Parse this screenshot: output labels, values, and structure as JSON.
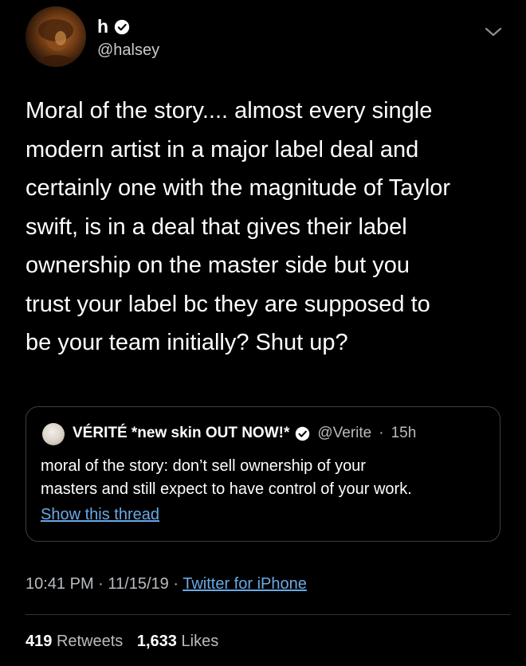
{
  "tweet": {
    "author": {
      "display_name": "h",
      "handle": "@halsey",
      "verified": true
    },
    "text": "Moral of the story.... almost every single\nmodern artist in a major label deal and\ncertainly one with the magnitude of Taylor\nswift, is in a deal that gives their label\nownership on the master side but you\ntrust your label bc they are supposed to\nbe your team initially? Shut up?",
    "quoted": {
      "display_name": "VÉRITÉ *new skin OUT NOW!*",
      "handle": "@Verite",
      "separator": "·",
      "age": "15h",
      "verified": true,
      "text": "moral of the story: don’t sell ownership of your\nmasters and still expect to have control of your work.",
      "show_thread_label": "Show this thread"
    },
    "time": "10:41 PM",
    "date": "11/15/19",
    "separator": "·",
    "source": "Twitter for iPhone",
    "stats": {
      "retweets_count": "419",
      "retweets_label": "Retweets",
      "likes_count": "1,633",
      "likes_label": "Likes"
    }
  },
  "icons": {
    "verified": "verified-badge-icon",
    "menu": "chevron-down-icon"
  },
  "colors": {
    "background": "#000000",
    "text": "#ffffff",
    "secondary_text": "#b8bcc0",
    "link": "#6aa9e6",
    "border": "#3a3d40"
  }
}
